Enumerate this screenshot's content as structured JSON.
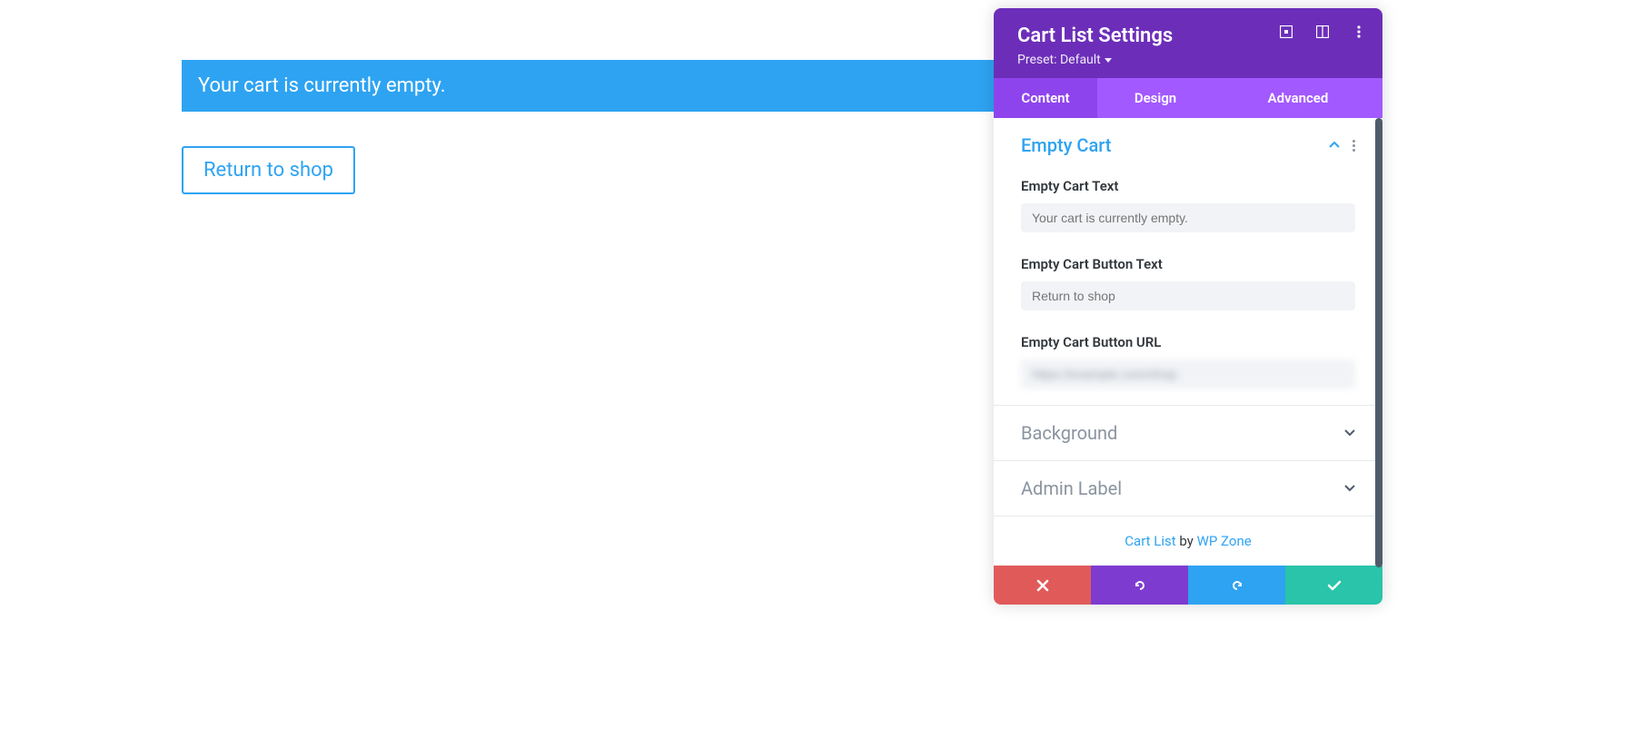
{
  "preview": {
    "notice_text": "Your cart is currently empty.",
    "return_button_label": "Return to shop"
  },
  "panel": {
    "title": "Cart List Settings",
    "preset_label": "Preset: Default",
    "tabs": {
      "content": "Content",
      "design": "Design",
      "advanced": "Advanced"
    },
    "sections": {
      "empty_cart": {
        "title": "Empty Cart",
        "fields": {
          "text_label": "Empty Cart Text",
          "text_placeholder": "Your cart is currently empty.",
          "button_text_label": "Empty Cart Button Text",
          "button_text_placeholder": "Return to shop",
          "button_url_label": "Empty Cart Button URL",
          "button_url_value": ""
        }
      },
      "background": {
        "title": "Background"
      },
      "admin_label": {
        "title": "Admin Label"
      }
    },
    "credit": {
      "link1": "Cart List",
      "by": " by ",
      "link2": "WP Zone"
    }
  }
}
